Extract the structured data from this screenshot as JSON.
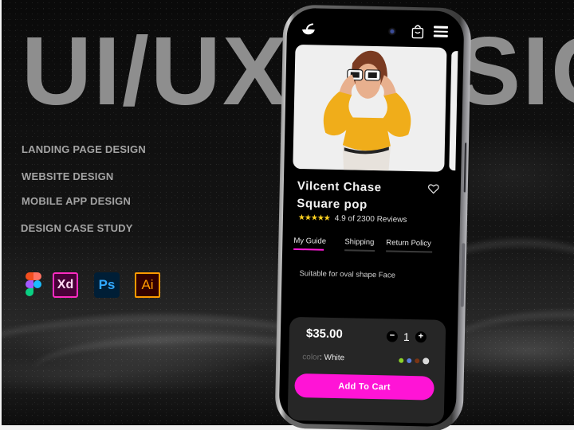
{
  "poster": {
    "big_title": "UI/UX DESIGN",
    "services": [
      "LANDING PAGE DESIGN",
      "WEBSITE DESIGN",
      "MOBILE APP DESIGN",
      "DESIGN CASE STUDY"
    ],
    "tools": [
      {
        "name": "figma-icon",
        "label": ""
      },
      {
        "name": "adobe-xd-icon",
        "label": "Xd"
      },
      {
        "name": "photoshop-icon",
        "label": "Ps"
      },
      {
        "name": "illustrator-icon",
        "label": "Ai"
      }
    ]
  },
  "app": {
    "header": {
      "logo_icon": "bowl-logo-icon",
      "cart_icon": "shopping-bag-icon",
      "menu_icon": "hamburger-menu-icon"
    },
    "product": {
      "name": "Vilcent  Chase\nSquare pop",
      "rating_stars": 5,
      "stars_text": "★★★★★",
      "rating_text": "4.9 of 2300 Reviews",
      "favorite_icon": "heart-outline-icon"
    },
    "tabs": [
      {
        "label": "My Guide",
        "active": true
      },
      {
        "label": "Shipping",
        "active": false
      },
      {
        "label": "Return Policy",
        "active": false
      }
    ],
    "description": "Suitable for oval shape Face",
    "purchase": {
      "price": "$35.00",
      "quantity": "1",
      "decrement_label": "−",
      "increment_label": "+",
      "color_label": "color",
      "color_value": ": White",
      "swatches": [
        {
          "name": "green",
          "color": "#8bd12a"
        },
        {
          "name": "blue",
          "color": "#5b7fe0"
        },
        {
          "name": "brown",
          "color": "#7a3414"
        },
        {
          "name": "white",
          "color": "#d9d9d9",
          "selected": true
        }
      ],
      "add_to_cart_label": "Add To Cart"
    },
    "colors": {
      "accent": "#ff14d6",
      "star": "#ffd21f",
      "card": "#262626"
    }
  }
}
